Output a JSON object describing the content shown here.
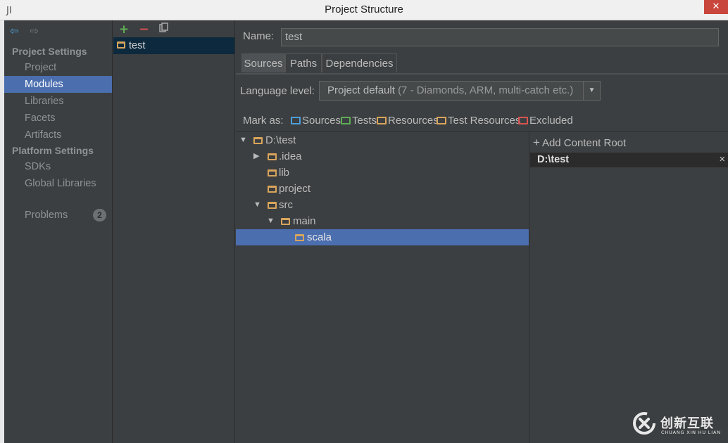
{
  "window": {
    "title": "Project Structure",
    "close_glyph": "✕",
    "app_icon": "intellij-icon"
  },
  "nav": {
    "back_icon": "back-arrow-icon",
    "forward_icon": "forward-arrow-icon",
    "section_project": "Project Settings",
    "section_platform": "Platform Settings",
    "items": [
      {
        "label": "Project"
      },
      {
        "label": "Modules"
      },
      {
        "label": "Libraries"
      },
      {
        "label": "Facets"
      },
      {
        "label": "Artifacts"
      },
      {
        "label": "SDKs"
      },
      {
        "label": "Global Libraries"
      },
      {
        "label": "Problems",
        "badge": "2"
      }
    ],
    "selected": "Modules"
  },
  "modules": {
    "add": "+",
    "remove": "−",
    "copy_icon": "copy-icon",
    "items": [
      {
        "label": "test"
      }
    ]
  },
  "main": {
    "name_label": "Name:",
    "name_value": "test",
    "tabs": [
      {
        "label": "Sources"
      },
      {
        "label": "Paths"
      },
      {
        "label": "Dependencies"
      }
    ],
    "active_tab": "Sources",
    "language_label": "Language level:",
    "language_value": "Project default",
    "language_detail": "(7 - Diamonds, ARM, multi-catch etc.)",
    "mark_as_label": "Mark as:",
    "mark_as": [
      {
        "label": "Sources",
        "color": "#4d9ed9"
      },
      {
        "label": "Tests",
        "color": "#5fad56"
      },
      {
        "label": "Resources",
        "color": "#d9a55b"
      },
      {
        "label": "Test Resources",
        "color": "#d9a55b"
      },
      {
        "label": "Excluded",
        "color": "#d9534f"
      }
    ],
    "tree": [
      {
        "label": "D:\\test",
        "expanded": true
      },
      {
        "label": ".idea",
        "expanded": false
      },
      {
        "label": "lib"
      },
      {
        "label": "project"
      },
      {
        "label": "src",
        "expanded": true
      },
      {
        "label": "main",
        "expanded": true
      },
      {
        "label": "scala",
        "selected": true
      }
    ],
    "add_content_root": "Add Content Root",
    "content_root": "D:\\test",
    "remove_root_glyph": "×"
  },
  "watermark": {
    "text": "创新互联",
    "sub": "CHUANG XIN HU LIAN"
  },
  "colors": {
    "accent": "#4b6eaf",
    "folder": "#d9a55b"
  }
}
